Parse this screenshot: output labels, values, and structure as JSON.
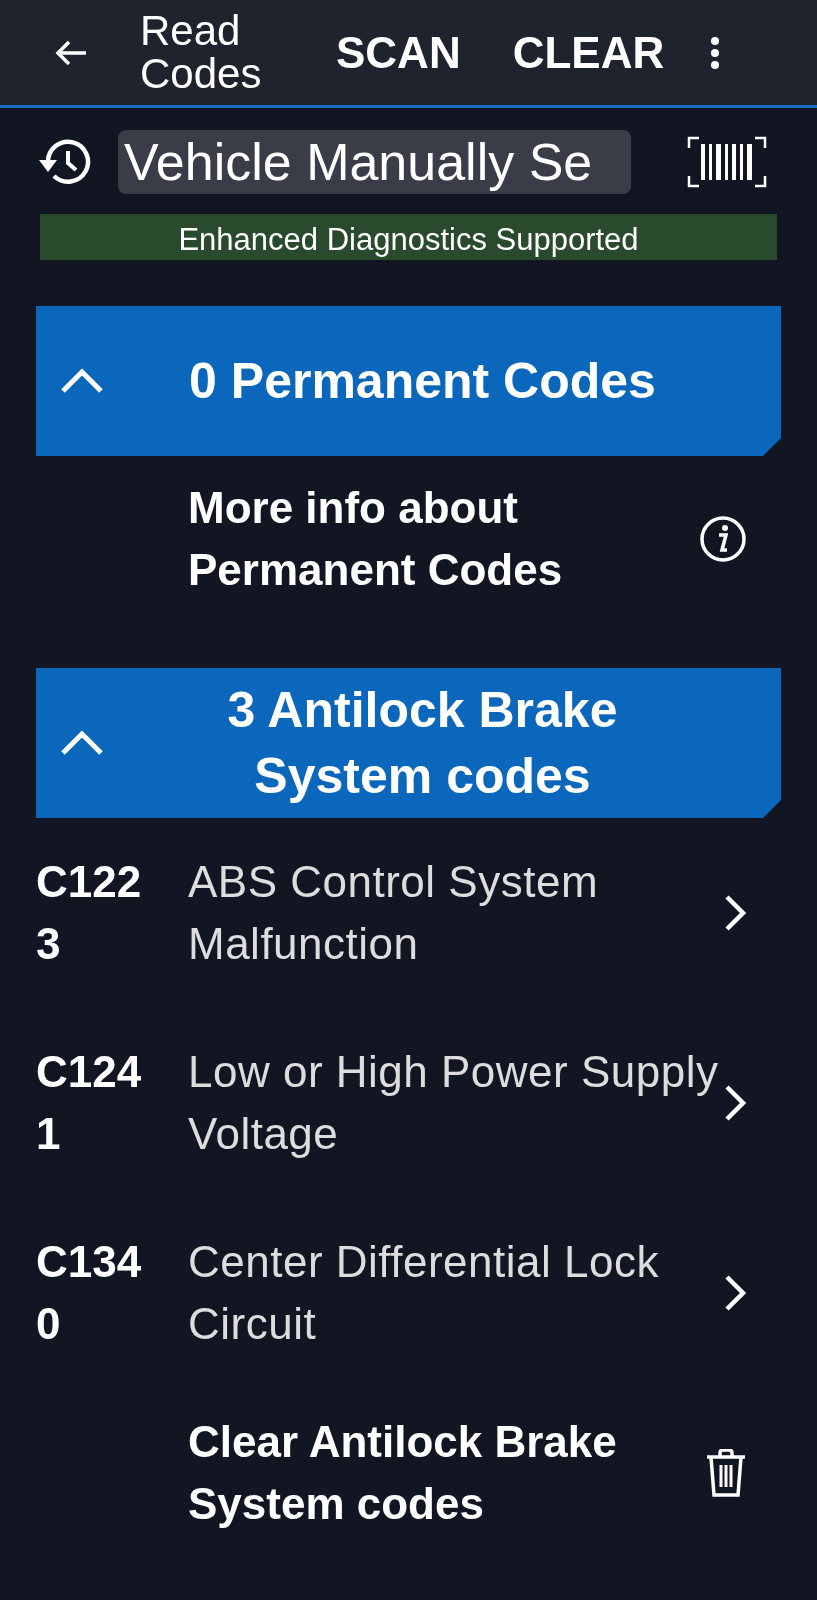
{
  "app_bar": {
    "title": "Read Codes",
    "actions": [
      "SCAN",
      "CLEAR"
    ]
  },
  "vehicle": {
    "value": "Vehicle Manually Se"
  },
  "banner": "Enhanced Diagnostics Supported",
  "sections": [
    {
      "title": "0 Permanent Codes",
      "expanded": true,
      "items": [
        {
          "kind": "info",
          "text": "More info about Permanent Codes"
        }
      ]
    },
    {
      "title": "3 Antilock Brake System codes",
      "expanded": true,
      "items": [
        {
          "kind": "code",
          "code": "C1223",
          "text": "ABS Control System Malfunction"
        },
        {
          "kind": "code",
          "code": "C1241",
          "text": "Low or High Power Supply Voltage"
        },
        {
          "kind": "code",
          "code": "C1340",
          "text": "Center Differential Lock Circuit"
        },
        {
          "kind": "clear",
          "text": "Clear Antilock Brake System codes"
        }
      ]
    }
  ]
}
